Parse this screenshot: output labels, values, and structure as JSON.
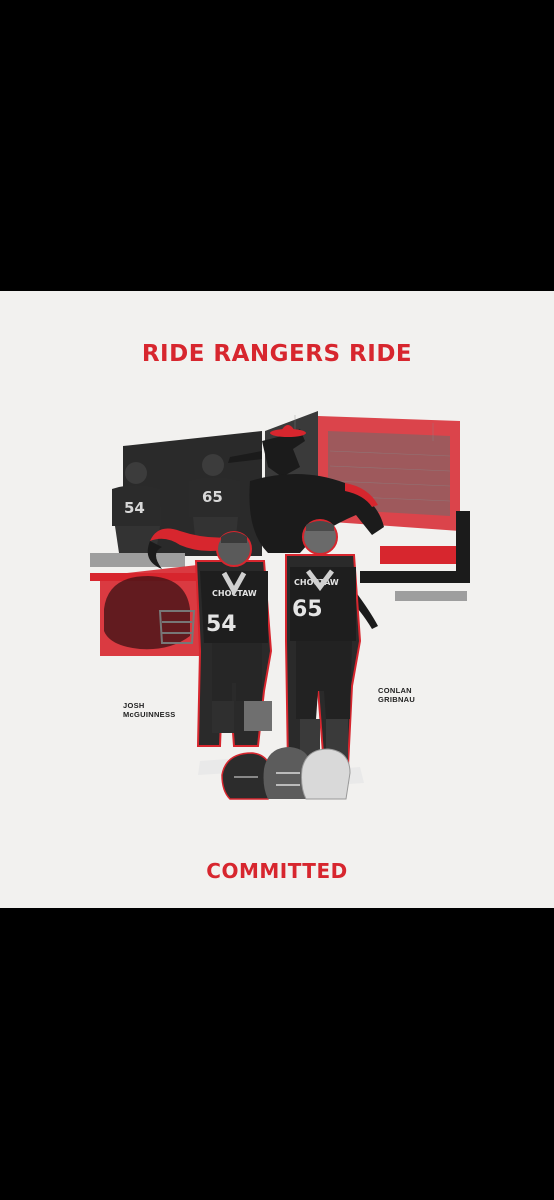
{
  "poster": {
    "headline": "RIDE RANGERS RIDE",
    "footer": "COMMITTED",
    "players": [
      {
        "first": "JOSH",
        "last": "McGUINNESS",
        "jersey": "54"
      },
      {
        "first": "CONLAN",
        "last": "GRIBNAU",
        "jersey": "65"
      }
    ],
    "jersey_wordmark": "CHOCTAW",
    "colors": {
      "accent": "#d7262e",
      "background": "#f2f1ef",
      "dark": "#1b1b1b"
    }
  }
}
